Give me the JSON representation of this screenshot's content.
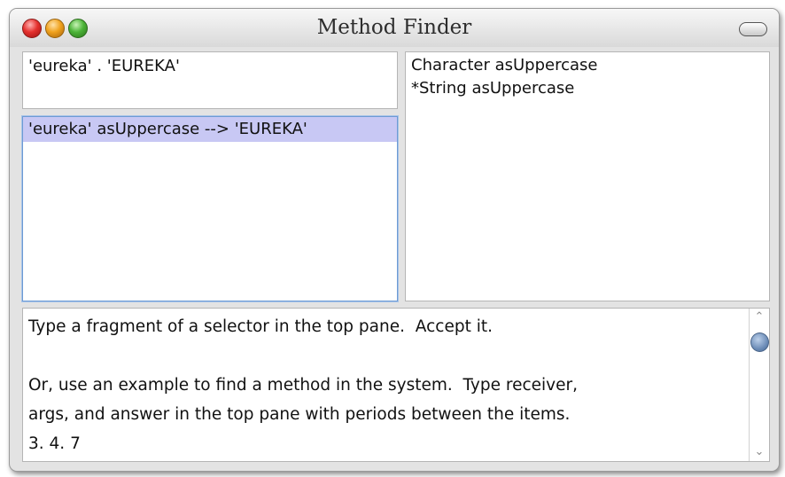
{
  "window": {
    "title": "Method Finder"
  },
  "selector_pane": {
    "value": "'eureka' . 'EUREKA'"
  },
  "examples_pane": {
    "selected_item": "'eureka' asUppercase --> 'EUREKA'"
  },
  "results_pane": {
    "items": [
      "Character asUppercase",
      "*String asUppercase"
    ]
  },
  "help_pane": {
    "lines": [
      "Type a fragment of a selector in the top pane.  Accept it.",
      "",
      "Or, use an example to find a method in the system.  Type receiver,",
      "args, and answer in the top pane with periods between the items.",
      "3. 4. 7"
    ]
  },
  "icons": {
    "close": "close-icon",
    "minimize": "minimize-icon",
    "maximize": "maximize-icon",
    "collapse": "collapse-icon",
    "scroll_up": "chevron-up-icon",
    "scroll_down": "chevron-down-icon"
  },
  "colors": {
    "selection_highlight": "#c8c8f4",
    "focus_border": "#6d9bd4",
    "window_background": "#e3e3e3"
  }
}
